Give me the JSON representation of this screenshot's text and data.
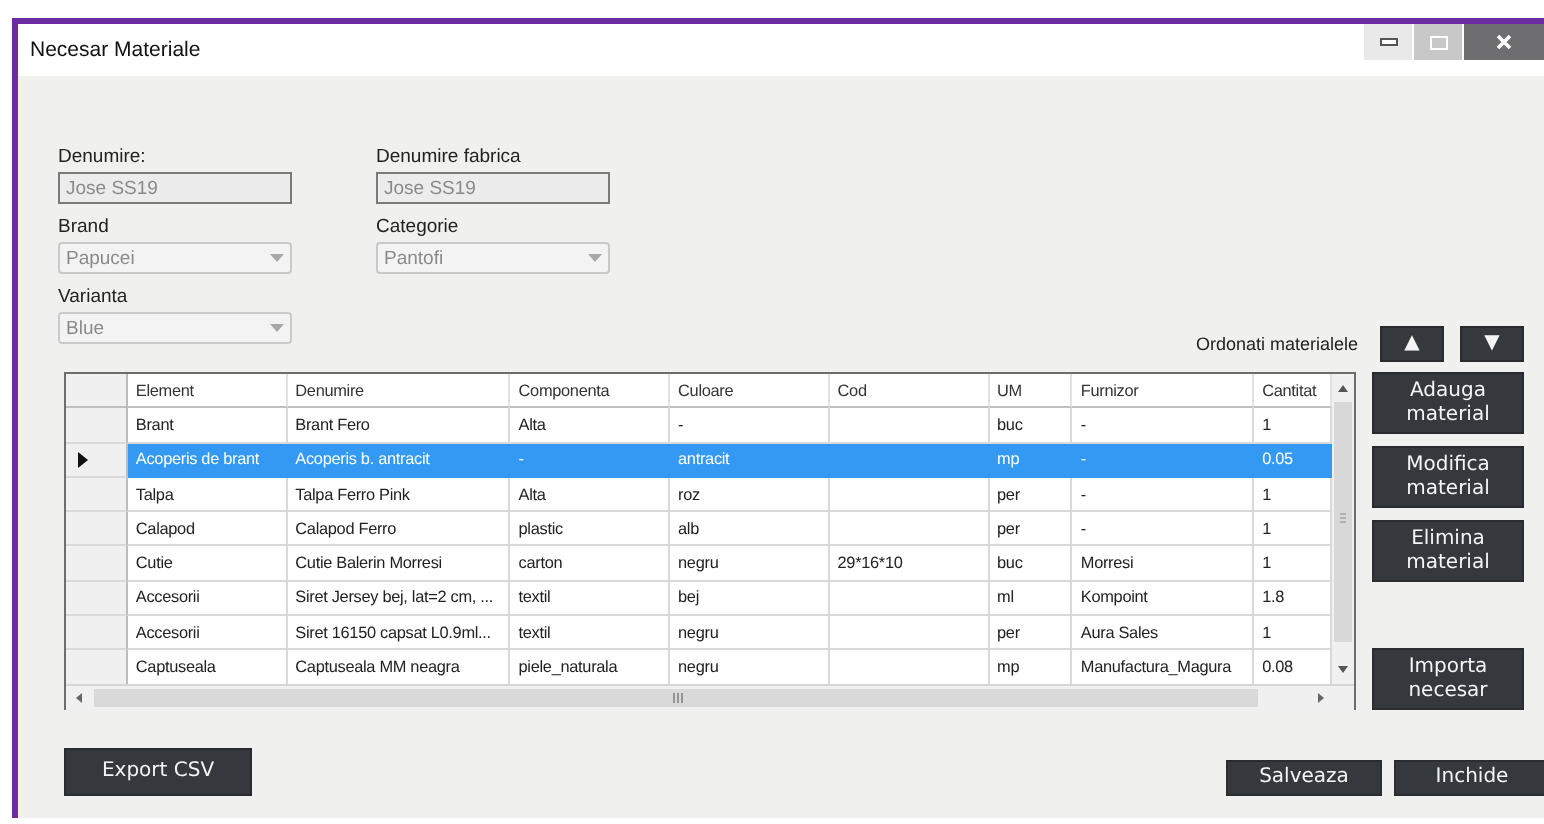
{
  "window": {
    "title": "Necesar Materiale"
  },
  "fields": [
    {
      "label": "Denumire:",
      "value": "Jose SS19",
      "kind": "text",
      "disabled": true
    },
    {
      "label": "Denumire fabrica",
      "value": "Jose SS19",
      "kind": "text",
      "disabled": true
    },
    {
      "label": "Brand",
      "value": "Papucei",
      "kind": "dropdown",
      "disabled": true
    },
    {
      "label": "Categorie",
      "value": "Pantofi",
      "kind": "dropdown",
      "disabled": true
    },
    {
      "label": "Varianta",
      "value": "Blue",
      "kind": "dropdown",
      "disabled": true
    }
  ],
  "ordering": {
    "label": "Ordonati materialele",
    "buttons": [
      "▲",
      "▼"
    ]
  },
  "table": {
    "columns": [
      "Element",
      "Denumire",
      "Componenta",
      "Culoare",
      "Cod",
      "UM",
      "Furnizor",
      "Cantitat"
    ],
    "rows": [
      {
        "cells": [
          "Brant",
          "Brant Fero",
          "Alta",
          "-",
          null,
          "buc",
          "-",
          "1"
        ],
        "selected": false
      },
      {
        "cells": [
          "Acoperis de brant",
          "Acoperis b. antracit",
          "-",
          "antracit",
          null,
          "mp",
          "-",
          "0.05"
        ],
        "selected": true
      },
      {
        "cells": [
          "Talpa",
          "Talpa Ferro Pink",
          "Alta",
          "roz",
          null,
          "per",
          "-",
          "1"
        ],
        "selected": false
      },
      {
        "cells": [
          "Calapod",
          "Calapod Ferro",
          "plastic",
          "alb",
          null,
          "per",
          "-",
          "1"
        ],
        "selected": false
      },
      {
        "cells": [
          "Cutie",
          "Cutie Balerin Morresi",
          "carton",
          "negru",
          "29*16*10",
          "buc",
          "Morresi",
          "1"
        ],
        "selected": false
      },
      {
        "cells": [
          "Accesorii",
          "Siret Jersey bej, lat=2 cm, ...",
          "textil",
          "bej",
          null,
          "ml",
          "Kompoint",
          "1.8"
        ],
        "selected": false
      },
      {
        "cells": [
          "Accesorii",
          "Siret 16150 capsat L0.9ml...",
          "textil",
          "negru",
          null,
          "per",
          "Aura Sales",
          "1"
        ],
        "selected": false
      },
      {
        "cells": [
          "Captuseala",
          "Captuseala MM neagra",
          "piele_naturala",
          "negru",
          null,
          "mp",
          "Manufactura_Magura",
          "0.08"
        ],
        "selected": false
      }
    ]
  },
  "side_buttons": [
    "Adauga material",
    "Modifica material",
    "Elimina material",
    "Importa necesar"
  ],
  "bottom_buttons": {
    "left": [
      "Export CSV"
    ],
    "right": [
      "Salveaza",
      "Inchide"
    ]
  }
}
